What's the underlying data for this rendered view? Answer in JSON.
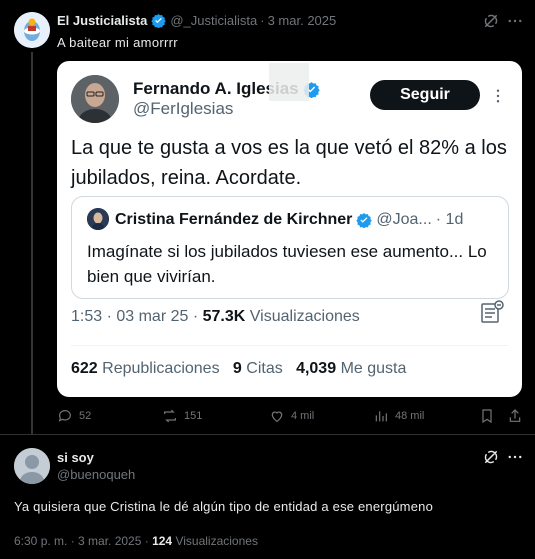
{
  "post1": {
    "author_name": "El Justicialista",
    "handle": "@_Justicialista",
    "separator": "·",
    "date": "3 mar. 2025",
    "text": "A baitear mi amorrrr",
    "actions": {
      "replies": "52",
      "reposts": "151",
      "likes": "4 mil",
      "views": "48 mil"
    }
  },
  "embedded": {
    "author_name": "Fernando A. Iglesias",
    "handle": "@FerIglesias",
    "follow_label": "Seguir",
    "text": "La que te gusta a vos es la que vetó el 82% a los jubilados, reina. Acordate.",
    "quote": {
      "author_name": "Cristina Fernández de Kirchner",
      "handle_trunc": "@Joa...",
      "age": "· 1d",
      "text": "Imagínate si los jubilados tuviesen ese aumento... Lo bien que vivirían."
    },
    "meta": {
      "time_date": "1:53 · 03 mar 25 · ",
      "views_count": "57.3K",
      "views_label": " Visualizaciones"
    },
    "stats": {
      "reposts_count": "622",
      "reposts_label": "Republicaciones",
      "quotes_count": "9",
      "quotes_label": "Citas",
      "likes_count": "4,039",
      "likes_label": "Me gusta"
    }
  },
  "post2": {
    "author_name": "si soy",
    "handle": "@buenoqueh",
    "text": "Ya quisiera que Cristina le dé algún tipo de entidad a ese energúmeno",
    "meta_time": "6:30 p. m. · 3 mar. 2025 · ",
    "views_count": "124",
    "views_label": " Visualizaciones"
  },
  "colors": {
    "background": "#000000",
    "text": "#e7e9ea",
    "muted": "#71767b",
    "verified": "#1d9bf0",
    "divider": "#2f3336"
  }
}
